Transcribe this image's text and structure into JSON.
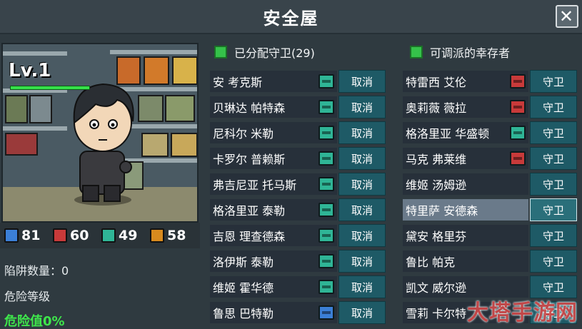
{
  "window": {
    "title": "安全屋",
    "close_label": "✕"
  },
  "character": {
    "level_label": "Lv.1"
  },
  "resources": [
    {
      "name": "blue-resource",
      "value": "81",
      "color": "#3b7fd6"
    },
    {
      "name": "red-resource",
      "value": "60",
      "color": "#c83a3a"
    },
    {
      "name": "teal-resource",
      "value": "49",
      "color": "#2fb596"
    },
    {
      "name": "orange-resource",
      "value": "58",
      "color": "#d78a1e"
    }
  ],
  "stats": {
    "traps_label": "陷阱数量：0",
    "danger_level_label": "危险等级",
    "danger_value_label": "危险值0%"
  },
  "assigned": {
    "header": "已分配守卫(29)",
    "action_label": "取消",
    "rows": [
      {
        "name": "安 考克斯",
        "badge": "#2fb596"
      },
      {
        "name": "贝琳达 帕特森",
        "badge": "#2fb596"
      },
      {
        "name": "尼科尔 米勒",
        "badge": "#2fb596"
      },
      {
        "name": "卡罗尔 普赖斯",
        "badge": "#2fb596"
      },
      {
        "name": "弗吉尼亚 托马斯",
        "badge": "#2fb596"
      },
      {
        "name": "格洛里亚 泰勒",
        "badge": "#2fb596"
      },
      {
        "name": "吉恩 理查德森",
        "badge": "#2fb596"
      },
      {
        "name": "洛伊斯 泰勒",
        "badge": "#2fb596"
      },
      {
        "name": "维姬 霍华德",
        "badge": "#2fb596"
      },
      {
        "name": "鲁思 巴特勒",
        "badge": "#3b7fd6"
      }
    ]
  },
  "available": {
    "header": "可调派的幸存者",
    "action_label": "守卫",
    "rows": [
      {
        "name": "特雷西 艾伦",
        "badge": "#c83a3a"
      },
      {
        "name": "奥莉薇 薇拉",
        "badge": "#c83a3a"
      },
      {
        "name": "格洛里亚 华盛顿",
        "badge": "#2fb596"
      },
      {
        "name": "马克 弗莱维",
        "badge": "#c83a3a"
      },
      {
        "name": "维姬 汤姆逊",
        "badge": ""
      },
      {
        "name": "特里萨 安德森",
        "badge": "",
        "selected": true
      },
      {
        "name": "黛安 格里芬",
        "badge": ""
      },
      {
        "name": "鲁比 帕克",
        "badge": ""
      },
      {
        "name": "凯文 威尔逊",
        "badge": ""
      },
      {
        "name": "雪莉 卡尔特",
        "badge": ""
      }
    ]
  },
  "watermark": "大塔手游网"
}
